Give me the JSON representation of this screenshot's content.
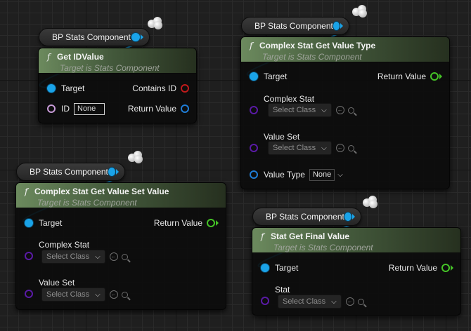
{
  "nodes": {
    "get_id_value": {
      "var_label": "BP Stats Component",
      "title": "Get IDValue",
      "subtitle": "Target is Stats Component",
      "target": "Target",
      "id_label": "ID",
      "id_value": "None",
      "contains_id": "Contains ID",
      "return_value": "Return Value"
    },
    "value_type": {
      "var_label": "BP Stats Component",
      "title": "Complex Stat Get Value Type",
      "subtitle": "Target is Stats Component",
      "target": "Target",
      "return_value": "Return Value",
      "complex_stat": "Complex Stat",
      "complex_stat_select": "Select Class",
      "value_set": "Value Set",
      "value_set_select": "Select Class",
      "value_type_label": "Value Type",
      "value_type_value": "None"
    },
    "value_set_value": {
      "var_label": "BP Stats Component",
      "title": "Complex Stat Get Value Set Value",
      "subtitle": "Target is Stats Component",
      "target": "Target",
      "return_value": "Return Value",
      "complex_stat": "Complex Stat",
      "complex_stat_select": "Select Class",
      "value_set": "Value Set",
      "value_set_select": "Select Class"
    },
    "final_value": {
      "var_label": "BP Stats Component",
      "title": "Stat Get Final Value",
      "subtitle": "Target is Stats Component",
      "target": "Target",
      "return_value": "Return Value",
      "stat": "Stat",
      "stat_select": "Select Class"
    }
  },
  "icons": {
    "function": "f",
    "dropdown": "chevron-down-icon",
    "use_selected": "arrow-left-circle-icon",
    "browse": "search-icon",
    "network": "component-cloud-icon"
  },
  "colors": {
    "object_pin": "#1aa3e8",
    "bool_pin": "#c01b1b",
    "float_pin": "#45c427",
    "name_pin": "#c89bd8",
    "class_pin": "#5a1aa6",
    "enum_pin": "#1f7dd6",
    "header_green": "#6c8a5e"
  }
}
